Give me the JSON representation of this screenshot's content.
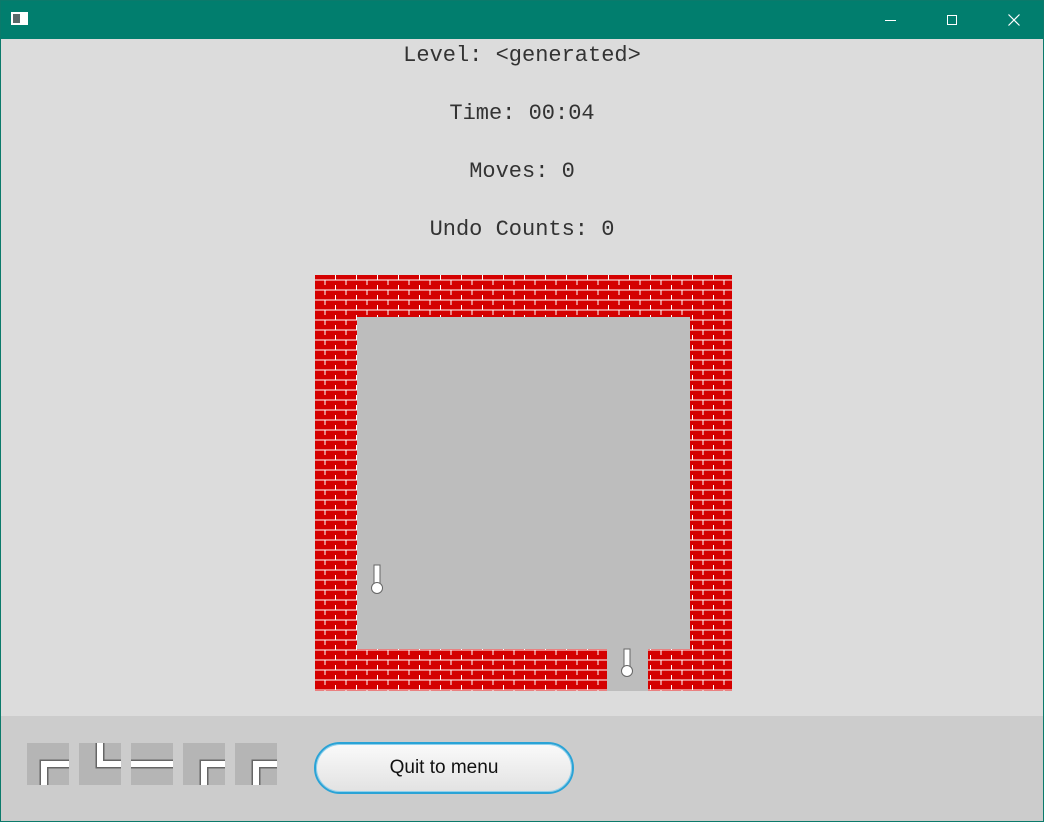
{
  "window": {
    "icon": "app-window-icon",
    "controls": [
      "minimize-icon",
      "maximize-icon",
      "close-icon"
    ],
    "title_bar_color": "#017e6e"
  },
  "stats": {
    "level_label": "Level:",
    "level_value": "<generated>",
    "time_label": "Time:",
    "time_value": "00:04",
    "moves_label": "Moves:",
    "moves_value": "0",
    "undo_label": "Undo Counts:",
    "undo_value": "0"
  },
  "board": {
    "wall_color": "#d40000",
    "floor_color": "#bdbdbd",
    "grid": {
      "cols": 10,
      "rows": 10
    },
    "start_pipe": {
      "col": 1,
      "row": 7,
      "direction": "up",
      "icon": "start-pipe-icon"
    },
    "end_pipe": {
      "col": 7,
      "row": 9,
      "direction": "up",
      "icon": "end-pipe-icon"
    }
  },
  "tile_queue": [
    {
      "type": "bend-down-right",
      "icon": "pipe-bend-down-right-icon"
    },
    {
      "type": "bend-up-right",
      "icon": "pipe-bend-up-right-icon"
    },
    {
      "type": "horizontal",
      "icon": "pipe-horizontal-icon"
    },
    {
      "type": "bend-down-right",
      "icon": "pipe-bend-down-right-icon"
    },
    {
      "type": "bend-down-right",
      "icon": "pipe-bend-down-right-icon"
    }
  ],
  "actions": {
    "quit_label": "Quit to menu",
    "quit_border_color": "#2aa3d6"
  }
}
